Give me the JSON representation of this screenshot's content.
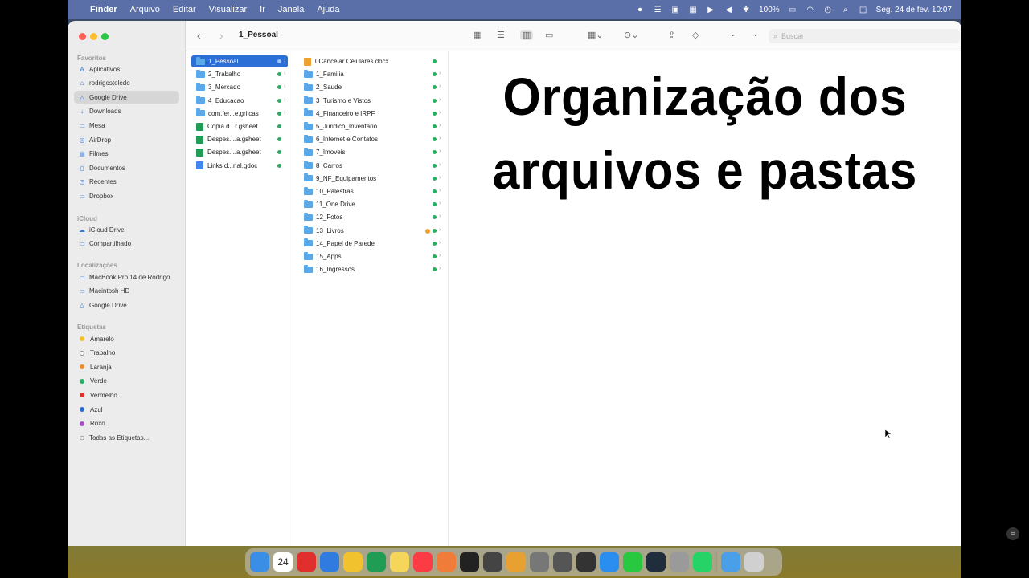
{
  "menubar": {
    "app_name": "Finder",
    "items": [
      "Arquivo",
      "Editar",
      "Visualizar",
      "Ir",
      "Janela",
      "Ajuda"
    ],
    "battery": "100%",
    "datetime": "Seg. 24 de fev. 10:07"
  },
  "toolbar": {
    "title": "1_Pessoal",
    "search_placeholder": "Buscar"
  },
  "sidebar": {
    "favorites_title": "Favoritos",
    "favorites": [
      {
        "label": "Aplicativos",
        "icon": "apps-icon"
      },
      {
        "label": "rodrigostoledo",
        "icon": "home-icon"
      },
      {
        "label": "Google Drive",
        "icon": "drive-icon"
      },
      {
        "label": "Downloads",
        "icon": "download-icon"
      },
      {
        "label": "Mesa",
        "icon": "desktop-icon"
      },
      {
        "label": "AirDrop",
        "icon": "airdrop-icon"
      },
      {
        "label": "Filmes",
        "icon": "film-icon"
      },
      {
        "label": "Documentos",
        "icon": "document-icon"
      },
      {
        "label": "Recentes",
        "icon": "clock-icon"
      },
      {
        "label": "Dropbox",
        "icon": "folder-icon"
      }
    ],
    "icloud_title": "iCloud",
    "icloud": [
      {
        "label": "iCloud Drive",
        "icon": "cloud-icon"
      },
      {
        "label": "Compartilhado",
        "icon": "shared-folder-icon"
      }
    ],
    "locations_title": "Localizações",
    "locations": [
      {
        "label": "MacBook Pro 14 de Rodrigo",
        "icon": "laptop-icon"
      },
      {
        "label": "Macintosh HD",
        "icon": "disk-icon"
      },
      {
        "label": "Google Drive",
        "icon": "drive-icon"
      }
    ],
    "tags_title": "Etiquetas",
    "tags": [
      {
        "label": "Amarelo",
        "color": "#f2c12e"
      },
      {
        "label": "Trabalho",
        "color": "#ffffff"
      },
      {
        "label": "Laranja",
        "color": "#f08a24"
      },
      {
        "label": "Verde",
        "color": "#27ae60"
      },
      {
        "label": "Vermelho",
        "color": "#e0302e"
      },
      {
        "label": "Azul",
        "color": "#2a6fd6"
      },
      {
        "label": "Roxo",
        "color": "#a64fc8"
      }
    ],
    "all_tags_label": "Todas as Etiquetas..."
  },
  "column1": [
    {
      "label": "1_Pessoal",
      "type": "folder",
      "selected": true
    },
    {
      "label": "2_Trabalho",
      "type": "folder"
    },
    {
      "label": "3_Mercado",
      "type": "folder"
    },
    {
      "label": "4_Educacao",
      "type": "folder"
    },
    {
      "label": "com.fer...e.grilcas",
      "type": "folder"
    },
    {
      "label": "Cópia d...r.gsheet",
      "type": "sheet"
    },
    {
      "label": "Despes....a.gsheet",
      "type": "sheet"
    },
    {
      "label": "Despes....a.gsheet",
      "type": "sheet"
    },
    {
      "label": "Links d...nal.gdoc",
      "type": "doc"
    }
  ],
  "column2": [
    {
      "label": "0Cancelar Celulares.docx",
      "type": "docx"
    },
    {
      "label": "1_Familia",
      "type": "folder"
    },
    {
      "label": "2_Saude",
      "type": "folder"
    },
    {
      "label": "3_Turismo e Vistos",
      "type": "folder"
    },
    {
      "label": "4_Financeiro e IRPF",
      "type": "folder"
    },
    {
      "label": "5_Juridico_Inventario",
      "type": "folder"
    },
    {
      "label": "6_Internet e Contatos",
      "type": "folder"
    },
    {
      "label": "7_Imoveis",
      "type": "folder"
    },
    {
      "label": "8_Carros",
      "type": "folder"
    },
    {
      "label": "9_NF_Equipamentos",
      "type": "folder"
    },
    {
      "label": "10_Palestras",
      "type": "folder"
    },
    {
      "label": "11_One Drive",
      "type": "folder"
    },
    {
      "label": "12_Fotos",
      "type": "folder"
    },
    {
      "label": "13_Livros",
      "type": "folder",
      "tag": "#f0a030"
    },
    {
      "label": "14_Papel de Parede",
      "type": "folder"
    },
    {
      "label": "15_Apps",
      "type": "folder"
    },
    {
      "label": "16_Ingressos",
      "type": "folder"
    }
  ],
  "preview": {
    "line1": "Organização dos",
    "line2": "arquivos e pastas"
  },
  "dock": {
    "calendar_day": "24",
    "apps": [
      "finder-icon",
      "calendar-icon",
      "opera-icon",
      "safari-icon",
      "chrome-icon",
      "testflight-icon",
      "notes-icon",
      "music-icon",
      "pixelmator-icon",
      "final-cut-icon",
      "logic-icon",
      "garageband-icon",
      "settings-icon",
      "screenshot-icon",
      "calculator-icon",
      "app-store-icon",
      "facetime-icon",
      "stocks-icon",
      "files-icon",
      "whatsapp-icon",
      "downloads-folder-icon",
      "trash-icon"
    ],
    "colors": [
      "#3a8ee6",
      "#ffffff",
      "#e0302e",
      "#2f7be0",
      "#f2c12e",
      "#1f9d55",
      "#f5d55a",
      "#fc3c44",
      "#f07c3a",
      "#222222",
      "#444444",
      "#e8a030",
      "#777777",
      "#555555",
      "#333333",
      "#2a8ef0",
      "#28c840",
      "#1f2d3d",
      "#9a9a9a",
      "#25d366",
      "#4aa0e8",
      "#d0d0d0"
    ]
  }
}
